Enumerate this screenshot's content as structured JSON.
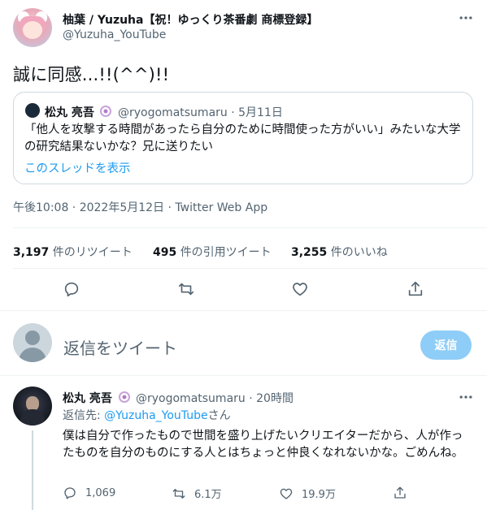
{
  "tweet": {
    "display_name": "柚葉 / Yuzuha【祝！ゆっくり茶番劇 商標登録】",
    "handle": "@Yuzuha_YouTube",
    "text": "誠に同感...!!(^^)!!",
    "timestamp": "午後10:08 · 2022年5月12日 · Twitter Web App"
  },
  "quoted": {
    "name": "松丸 亮吾",
    "handle_date": "@ryogomatsumaru · 5月11日",
    "text": "「他人を攻撃する時間があったら自分のために時間使った方がいい」みたいな大学の研究結果ないかな？兄に送りたい",
    "show_thread": "このスレッドを表示"
  },
  "stats": {
    "retweets_count": "3,197",
    "retweets_label": "件のリツイート",
    "quotes_count": "495",
    "quotes_label": "件の引用ツイート",
    "likes_count": "3,255",
    "likes_label": "件のいいね"
  },
  "actions": {
    "reply_icon": "reply-icon",
    "retweet_icon": "retweet-icon",
    "like_icon": "heart-icon",
    "share_icon": "share-icon"
  },
  "composer": {
    "placeholder": "返信をツイート",
    "button": "返信"
  },
  "reply": {
    "name": "松丸 亮吾",
    "handle_time": "@ryogomatsumaru · 20時間",
    "reply_to_prefix": "返信先: ",
    "reply_to_handle": "@Yuzuha_YouTube",
    "reply_to_suffix": "さん",
    "text": "僕は自分で作ったもので世間を盛り上げたいクリエイターだから、人が作ったものを自分のものにする人とはちょっと仲良くなれないかな。ごめんね。",
    "reply_count": "1,069",
    "retweet_count": "6.1万",
    "like_count": "19.9万"
  },
  "colors": {
    "accent": "#1d9bf0",
    "reply_button_disabled": "#8ecdf8",
    "text": "#0f1419",
    "muted": "#536471",
    "border": "#cfd9de"
  }
}
